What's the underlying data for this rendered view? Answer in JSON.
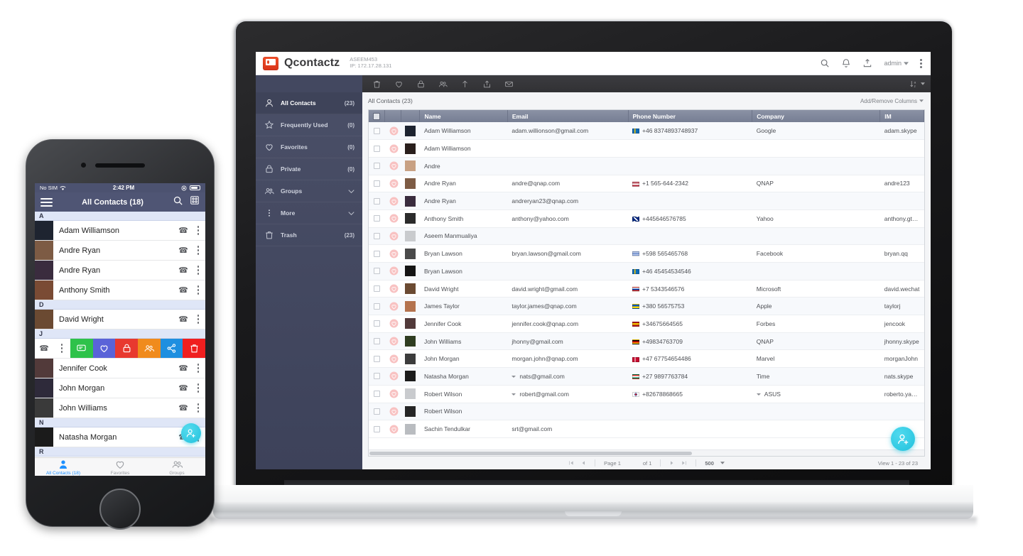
{
  "app": {
    "brand": "Qcontactz",
    "device_name": "ASEEM453",
    "ip_label": "IP: 172.17.28.131",
    "user": "admin",
    "icons": {
      "search": "search-icon",
      "bell": "bell-icon",
      "backup": "backup-icon",
      "kebab": "overflow-menu-icon"
    }
  },
  "sidebar": {
    "items": [
      {
        "label": "All Contacts",
        "count": "(23)",
        "icon": "person-icon",
        "active": true,
        "chevron": false
      },
      {
        "label": "Frequently Used",
        "count": "(0)",
        "icon": "star-icon",
        "active": false,
        "chevron": false
      },
      {
        "label": "Favorites",
        "count": "(0)",
        "icon": "heart-icon",
        "active": false,
        "chevron": false
      },
      {
        "label": "Private",
        "count": "(0)",
        "icon": "lock-icon",
        "active": false,
        "chevron": false
      },
      {
        "label": "Groups",
        "count": "",
        "icon": "group-icon",
        "active": false,
        "chevron": true
      },
      {
        "label": "More",
        "count": "",
        "icon": "dots-icon",
        "active": false,
        "chevron": true
      },
      {
        "label": "Trash",
        "count": "(23)",
        "icon": "trash-icon",
        "active": false,
        "chevron": false
      }
    ]
  },
  "toolbar": {
    "actions": [
      "delete-icon",
      "favorite-icon",
      "private-icon",
      "group-icon",
      "import-icon",
      "export-icon",
      "mail-icon"
    ],
    "sort_label": "sort-az-icon"
  },
  "breadcrumb": "All Contacts (23)",
  "add_remove_columns": "Add/Remove Columns",
  "table": {
    "columns": [
      "",
      "",
      "",
      "Name",
      "Email",
      "Phone Number",
      "Company",
      "IM"
    ],
    "rows": [
      {
        "name": "Adam Williamson",
        "email": "adam.willionson@gmail.com",
        "flag": "se",
        "phone": "+46 8374893748937",
        "company": "Google",
        "im": "adam.skype",
        "av": "#1e2430",
        "caret_phone": false,
        "caret_email": false,
        "caret_company": false
      },
      {
        "name": "Adam Williamson",
        "email": "",
        "flag": "",
        "phone": "",
        "company": "",
        "im": "",
        "av": "#2a1f1c",
        "caret_phone": false,
        "caret_email": false,
        "caret_company": false
      },
      {
        "name": "Andre",
        "email": "",
        "flag": "",
        "phone": "",
        "company": "",
        "im": "",
        "av": "#c8a183",
        "caret_phone": false,
        "caret_email": false,
        "caret_company": false
      },
      {
        "name": "Andre Ryan",
        "email": "andre@qnap.com",
        "flag": "us",
        "phone": "+1 565-644-2342",
        "company": "QNAP",
        "im": "andre123",
        "av": "#7d5b44",
        "caret_phone": false,
        "caret_email": false,
        "caret_company": false
      },
      {
        "name": "Andre Ryan",
        "email": "andreryan23@qnap.com",
        "flag": "",
        "phone": "",
        "company": "",
        "im": "",
        "av": "#3a2c3e",
        "caret_phone": false,
        "caret_email": false,
        "caret_company": false
      },
      {
        "name": "Anthony Smith",
        "email": "anthony@yahoo.com",
        "flag": "gb",
        "phone": "+445646576785",
        "company": "Yahoo",
        "im": "anthony.gtalk",
        "av": "#2b2b2b",
        "caret_phone": false,
        "caret_email": false,
        "caret_company": false
      },
      {
        "name": "Aseem Manmualiya",
        "email": "",
        "flag": "",
        "phone": "",
        "company": "",
        "im": "",
        "av": "#c9cbce",
        "caret_phone": false,
        "caret_email": false,
        "caret_company": false
      },
      {
        "name": "Bryan Lawson",
        "email": "bryan.lawson@gmail.com",
        "flag": "uy",
        "phone": "+598 565465768",
        "company": "Facebook",
        "im": "bryan.qq",
        "av": "#4a4a4a",
        "caret_phone": false,
        "caret_email": false,
        "caret_company": false
      },
      {
        "name": "Bryan Lawson",
        "email": "",
        "flag": "se",
        "phone": "+46 45454534546",
        "company": "",
        "im": "",
        "av": "#141414",
        "caret_phone": false,
        "caret_email": false,
        "caret_company": false
      },
      {
        "name": "David Wright",
        "email": "david.wright@gmail.com",
        "flag": "ru",
        "phone": "+7 5343546576",
        "company": "Microsoft",
        "im": "david.wechat",
        "av": "#6b4a32",
        "caret_phone": false,
        "caret_email": false,
        "caret_company": false
      },
      {
        "name": "James Taylor",
        "email": "taylor.james@qnap.com",
        "flag": "ua",
        "phone": "+380 56575753",
        "company": "Apple",
        "im": "taylorj",
        "av": "#b4734e",
        "caret_phone": false,
        "caret_email": false,
        "caret_company": false
      },
      {
        "name": "Jennifer Cook",
        "email": "jennifer.cook@qnap.com",
        "flag": "es",
        "phone": "+34675664565",
        "company": "Forbes",
        "im": "jencook",
        "av": "#523a3a",
        "caret_phone": false,
        "caret_email": false,
        "caret_company": false
      },
      {
        "name": "John Williams",
        "email": "jhonny@gmail.com",
        "flag": "de",
        "phone": "+49834763709",
        "company": "QNAP",
        "im": "jhonny.skype",
        "av": "#2f3d21",
        "caret_phone": false,
        "caret_email": false,
        "caret_company": false
      },
      {
        "name": "John Morgan",
        "email": "morgan.john@qnap.com",
        "flag": "dk",
        "phone": "+47 67754654486",
        "company": "Marvel",
        "im": "morganJohn",
        "av": "#3c3c3c",
        "caret_phone": false,
        "caret_email": false,
        "caret_company": false
      },
      {
        "name": "Natasha Morgan",
        "email": "nats@gmail.com",
        "flag": "za",
        "phone": "+27 9897763784",
        "company": "Time",
        "im": "nats.skype",
        "av": "#1b1b1b",
        "caret_phone": false,
        "caret_email": true,
        "caret_company": false
      },
      {
        "name": "Robert Wilson",
        "email": "robert@gmail.com",
        "flag": "kr",
        "phone": "+82678868665",
        "company": "ASUS",
        "im": "roberto.yahoo",
        "av": "#c9cbce",
        "caret_phone": false,
        "caret_email": true,
        "caret_company": true
      },
      {
        "name": "Robert Wilson",
        "email": "",
        "flag": "",
        "phone": "",
        "company": "",
        "im": "",
        "av": "#262626",
        "caret_phone": false,
        "caret_email": false,
        "caret_company": false
      },
      {
        "name": "Sachin Tendulkar",
        "email": "srt@gmail.com",
        "flag": "",
        "phone": "",
        "company": "",
        "im": "",
        "av": "#b9bcc0",
        "caret_phone": false,
        "caret_email": false,
        "caret_company": false
      }
    ]
  },
  "pager": {
    "first": "first-page-icon",
    "prev": "prev-page-icon",
    "page_label": "Page 1",
    "of_label": "of 1",
    "next": "next-page-icon",
    "last": "last-page-icon",
    "page_size": "500",
    "view_count": "View 1 - 23 of 23"
  },
  "fab": {
    "label": "add-contact-icon"
  },
  "phone": {
    "status": {
      "carrier": "No SIM",
      "wifi": "wifi-icon",
      "time": "2:42 PM",
      "lock": "rotation-lock-icon"
    },
    "nav": {
      "title": "All Contacts (18)",
      "menu": "hamburger-icon",
      "search": "search-icon",
      "grid": "grid-view-icon"
    },
    "sections": [
      {
        "letter": "A",
        "rows": [
          {
            "name": "Adam Williamson",
            "av": "#1e2430"
          },
          {
            "name": "Andre Ryan",
            "av": "#7d5b44"
          },
          {
            "name": "Andre Ryan",
            "av": "#3a2c3e"
          },
          {
            "name": "Anthony Smith",
            "av": "#7a4b34"
          }
        ]
      },
      {
        "letter": "D",
        "rows": [
          {
            "name": "David Wright",
            "av": "#6b4a32"
          }
        ]
      },
      {
        "letter": "J",
        "rows": [
          {
            "name": "Jennifer Cook",
            "av": "#523a3a"
          },
          {
            "name": "John Morgan",
            "av": "#2e2a3a"
          },
          {
            "name": "John Williams",
            "av": "#3a3a3a"
          }
        ]
      },
      {
        "letter": "N",
        "rows": [
          {
            "name": "Natasha Morgan",
            "av": "#1b1b1b"
          }
        ]
      },
      {
        "letter": "R",
        "rows": []
      }
    ],
    "swipe_actions": [
      {
        "icon": "sms-icon",
        "color": "#2ec24a"
      },
      {
        "icon": "favorite-icon",
        "color": "#5a63d8"
      },
      {
        "icon": "private-icon",
        "color": "#e8392f"
      },
      {
        "icon": "group-icon",
        "color": "#f08b1d"
      },
      {
        "icon": "share-icon",
        "color": "#1e8fe0"
      },
      {
        "icon": "delete-icon",
        "color": "#f01f1f"
      }
    ],
    "tabs": [
      {
        "label": "All Contacts (18)",
        "icon": "person-icon",
        "active": true
      },
      {
        "label": "Favorites",
        "icon": "heart-icon",
        "active": false
      },
      {
        "label": "Groups",
        "icon": "group-icon",
        "active": false
      }
    ],
    "fab": "add-contact-icon"
  },
  "colors": {
    "sidebar": "#454a62",
    "header_bar": "#353538",
    "accent_cyan": "#22c2dd",
    "heart_pink": "#f4a0a0",
    "table_header": "#7c8397"
  }
}
